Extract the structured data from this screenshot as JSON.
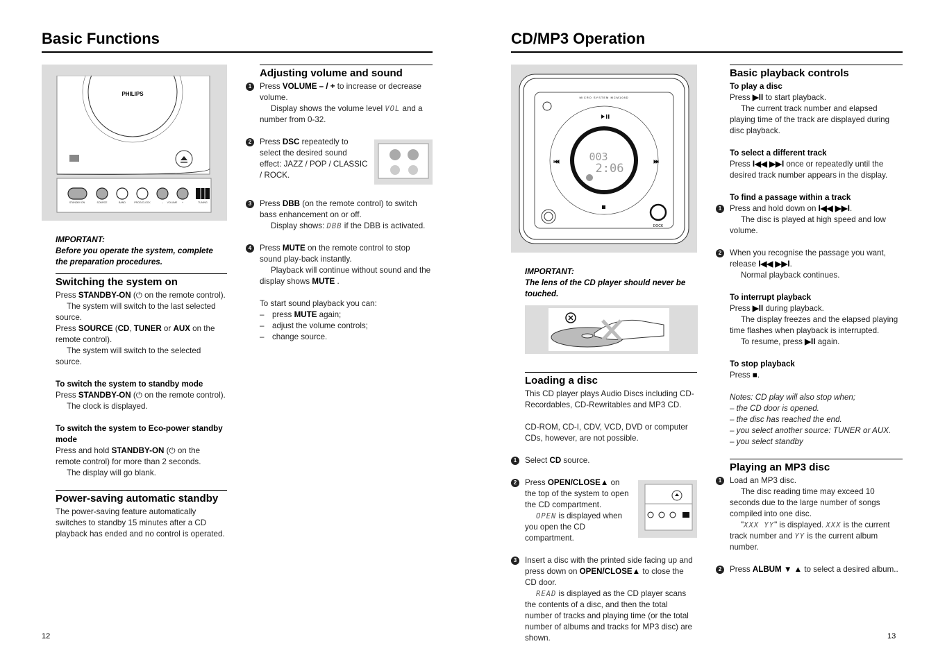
{
  "pages": {
    "left": {
      "title": "Basic Functions",
      "number": "12"
    },
    "right": {
      "title": "CD/MP3 Operation",
      "number": "13"
    }
  },
  "figures": {
    "front_panel": {
      "brand": "PHILIPS",
      "buttons": [
        "STANDBY-ON",
        "SOURCE",
        "BAND",
        "PROG/CLOCK",
        "–",
        "VOLUME",
        "+",
        "TUNING"
      ]
    },
    "cd_top": {
      "model": "MICRO SYSTEM MCM108D",
      "display_track": "003",
      "display_time": "2:06",
      "dock": "DOCK"
    }
  },
  "columns": {
    "left1": [
      {
        "t": "fig",
        "fig": "front_panel"
      },
      {
        "t": "imp",
        "lines": [
          "IMPORTANT:",
          "Before you operate the system, complete the preparation procedures."
        ]
      },
      {
        "t": "h",
        "text": "Switching the system on"
      },
      {
        "t": "g",
        "lines": [
          {
            "text": "Press **STANDBY-ON** (⏻ on the remote control)."
          },
          {
            "text": "The system will switch to the last selected source.",
            "indent": true
          },
          {
            "text": "Press **SOURCE** (**CD**, **TUNER** or **AUX** on the remote control)."
          },
          {
            "text": "The system will switch to the selected source.",
            "indent": true
          }
        ]
      },
      {
        "t": "sub",
        "text": "To switch the system to standby mode"
      },
      {
        "t": "g",
        "lines": [
          {
            "text": "Press **STANDBY-ON** (⏻ on the remote control)."
          },
          {
            "text": "The clock is displayed.",
            "indent": true
          }
        ]
      },
      {
        "t": "sub",
        "text": "To switch the system to Eco-power standby mode"
      },
      {
        "t": "g",
        "lines": [
          {
            "text": "Press and hold **STANDBY-ON** (⏻ on the remote control) for more than 2 seconds."
          },
          {
            "text": "The display will go blank.",
            "indent": true
          }
        ]
      },
      {
        "t": "h",
        "text": "Power-saving automatic standby"
      },
      {
        "t": "g",
        "lines": [
          {
            "text": "The power-saving feature automatically switches to standby 15 minutes after a CD playback has ended and no control is operated."
          }
        ]
      }
    ],
    "left2": [
      {
        "t": "h",
        "text": "Adjusting volume and sound"
      },
      {
        "t": "g",
        "n": "1",
        "lines": [
          {
            "text": "Press **VOLUME – / +** to increase or decrease volume."
          },
          {
            "text": "Display shows the volume level `VOL` and a number from 0-32.",
            "indent": true
          }
        ]
      },
      {
        "t": "g",
        "n": "2",
        "fig": "dsc_buttons",
        "lines": [
          {
            "text": "Press **DSC** repeatedly to select the desired sound effect: JAZZ / POP / CLASSIC / ROCK."
          }
        ]
      },
      {
        "t": "g",
        "n": "3",
        "lines": [
          {
            "text": "Press **DBB** (on the remote control) to switch bass enhancement on or off."
          },
          {
            "text": "Display shows: `DBB` if the DBB is activated.",
            "indent": true
          }
        ]
      },
      {
        "t": "g",
        "n": "4",
        "lines": [
          {
            "text": "Press **MUTE** on the remote control to stop sound play-back instantly."
          },
          {
            "text": "Playback will continue without sound and the display shows **MUTE** .",
            "indent": true
          }
        ]
      },
      {
        "t": "g",
        "lines": [
          {
            "text": "To start sound playback you can:"
          }
        ],
        "dashes": [
          "press **MUTE** again;",
          "adjust the volume controls;",
          "change source."
        ]
      }
    ],
    "right1": [
      {
        "t": "fig",
        "fig": "cd_top"
      },
      {
        "t": "imp",
        "lines": [
          "IMPORTANT:",
          "The lens of the CD player should never be touched."
        ]
      },
      {
        "t": "fig",
        "fig": "lens_warning"
      },
      {
        "t": "h",
        "text": "Loading a disc"
      },
      {
        "t": "g",
        "lines": [
          {
            "text": "This CD player plays Audio Discs including CD-Recordables, CD-Rewritables and MP3 CD."
          }
        ]
      },
      {
        "t": "g",
        "lines": [
          {
            "text": "CD-ROM, CD-I, CDV, VCD, DVD or computer CDs, however, are not possible."
          }
        ]
      },
      {
        "t": "g",
        "n": "1",
        "lines": [
          {
            "text": "Select **CD** source."
          }
        ]
      },
      {
        "t": "g",
        "n": "2",
        "fig": "open_close",
        "lines": [
          {
            "text": "Press **OPEN/CLOSE▲** on the top of the system to open the CD compartment."
          },
          {
            "text": "`OPEN` is displayed when you open the CD compartment.",
            "indent": true
          }
        ]
      },
      {
        "t": "g",
        "n": "3",
        "lines": [
          {
            "text": "Insert a disc with the printed side facing up and press down on **OPEN/CLOSE▲** to close the CD door."
          },
          {
            "text": "`READ` is displayed as the CD player scans the contents of a disc, and then the total number of tracks and playing time (or the total number of albums and tracks for MP3 disc) are shown.",
            "indent": true
          }
        ]
      }
    ],
    "right2": [
      {
        "t": "h",
        "text": "Basic playback controls"
      },
      {
        "t": "sub",
        "text": "To play a disc"
      },
      {
        "t": "g",
        "lines": [
          {
            "text": "Press **▶II** to start playback."
          },
          {
            "text": "The current track number and elapsed playing time of the track are displayed during disc playback.",
            "indent": true
          }
        ]
      },
      {
        "t": "sub",
        "text": "To select a different track"
      },
      {
        "t": "g",
        "lines": [
          {
            "text": "Press **I◀◀ ▶▶I** once or repeatedly until the desired track number appears in the display."
          }
        ]
      },
      {
        "t": "sub",
        "text": "To find a passage within a track"
      },
      {
        "t": "g",
        "n": "1",
        "lines": [
          {
            "text": "Press and hold down on **I◀◀ ▶▶I**."
          },
          {
            "text": "The disc is played at high speed and low volume.",
            "indent": true
          }
        ]
      },
      {
        "t": "g",
        "n": "2",
        "lines": [
          {
            "text": "When you recognise the passage you want, release **I◀◀ ▶▶I**."
          },
          {
            "text": "Normal playback continues.",
            "indent": true
          }
        ]
      },
      {
        "t": "sub",
        "text": "To interrupt playback"
      },
      {
        "t": "g",
        "lines": [
          {
            "text": "Press **▶II** during playback."
          },
          {
            "text": "The display freezes and the elapsed playing time flashes when playback is interrupted.",
            "indent": true
          },
          {
            "text": "To resume, press **▶II** again.",
            "indent": true
          }
        ]
      },
      {
        "t": "sub",
        "text": "To stop playback"
      },
      {
        "t": "g",
        "lines": [
          {
            "text": "Press **■**."
          }
        ]
      },
      {
        "t": "notes",
        "lines": [
          "Notes: CD play will also stop when;",
          "– the CD door is opened.",
          "– the disc has reached the end.",
          "– you select another source: TUNER or AUX.",
          "– you select standby"
        ]
      },
      {
        "t": "h",
        "text": "Playing an MP3 disc"
      },
      {
        "t": "g",
        "n": "1",
        "lines": [
          {
            "text": "Load an MP3 disc."
          },
          {
            "text": "The disc reading time may exceed 10 seconds due to the large number of songs compiled into one disc.",
            "indent": true
          },
          {
            "text": "\"`XXX YY`\" is displayed. `XXX` is the current track number and `YY` is the current album number.",
            "indent": true
          }
        ]
      },
      {
        "t": "g",
        "n": "2",
        "lines": [
          {
            "text": "Press **ALBUM ▼ ▲** to select a desired album.."
          }
        ]
      }
    ]
  }
}
